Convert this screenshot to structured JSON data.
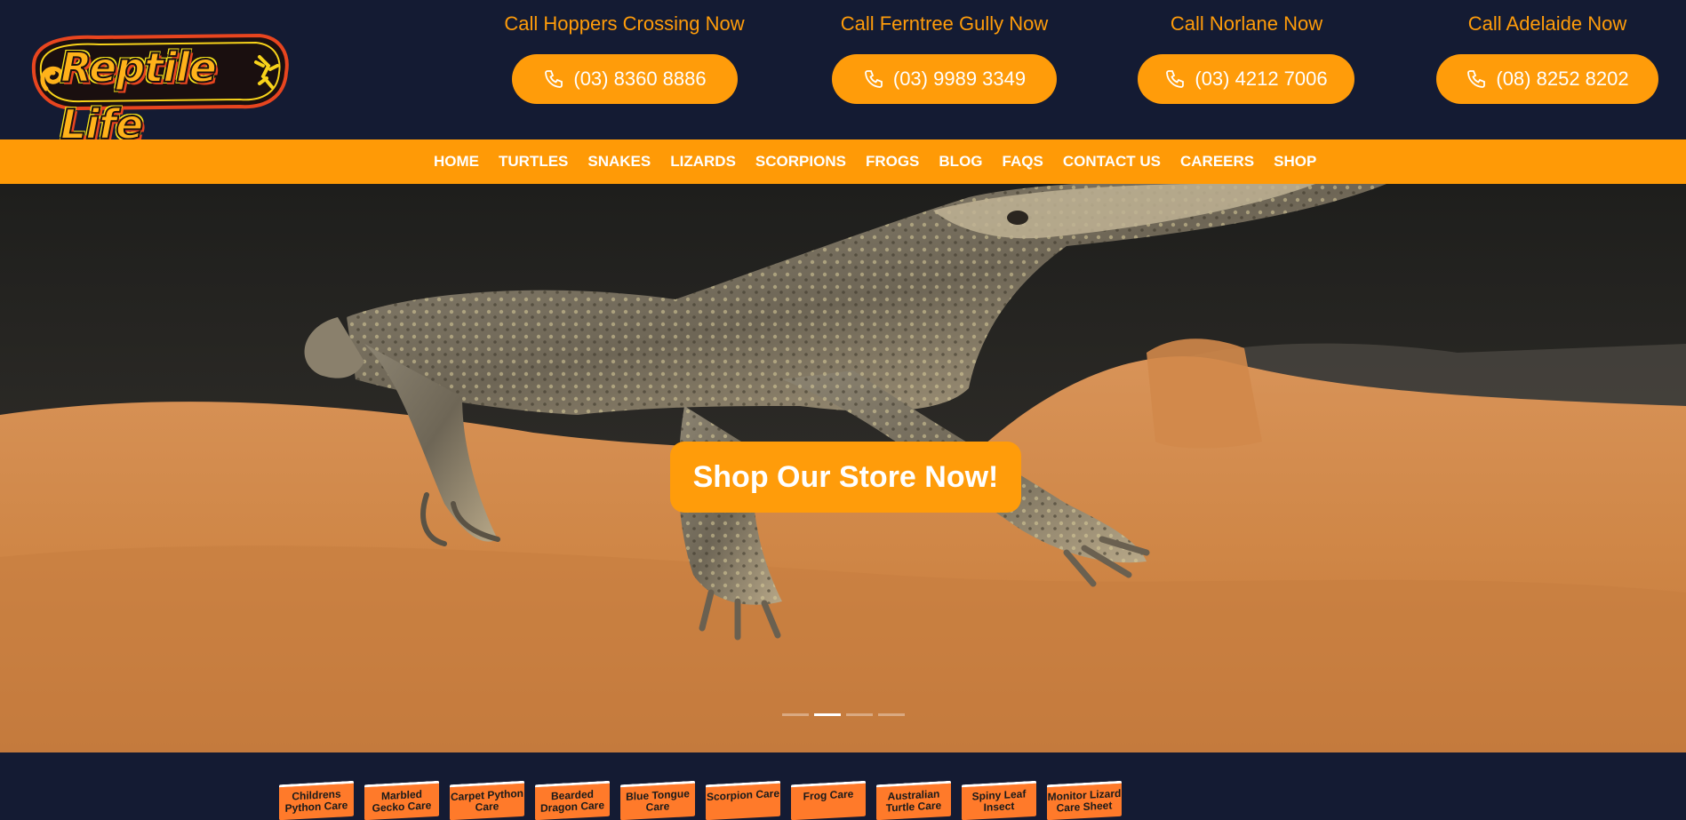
{
  "brand": {
    "name": "Reptile Life"
  },
  "locations": [
    {
      "title": "Call Hoppers Crossing Now",
      "phone": "(03) 8360 8886"
    },
    {
      "title": "Call Ferntree Gully Now",
      "phone": "(03) 9989 3349"
    },
    {
      "title": "Call Norlane Now",
      "phone": "(03) 4212 7006"
    },
    {
      "title": "Call Adelaide Now",
      "phone": "(08) 8252 8202"
    }
  ],
  "nav": {
    "items": [
      "HOME",
      "TURTLES",
      "SNAKES",
      "LIZARDS",
      "SCORPIONS",
      "FROGS",
      "BLOG",
      "FAQS",
      "CONTACT US",
      "CAREERS",
      "SHOP"
    ]
  },
  "hero": {
    "cta_label": "Shop Our Store Now!",
    "slides_total": 4,
    "active_slide": 2
  },
  "care_books": [
    "Childrens Python Care",
    "Marbled Gecko Care",
    "Carpet Python Care",
    "Bearded Dragon Care",
    "Blue Tongue Care",
    "Scorpion Care",
    "Frog Care",
    "Australian Turtle Care",
    "Spiny Leaf Insect",
    "Monitor Lizard Care Sheet"
  ],
  "colors": {
    "header_bg": "#141b33",
    "accent": "#ff9c0a",
    "nav_bg": "#ff9a06",
    "button_text": "#ffffff"
  },
  "icons": {
    "phone": "phone-icon"
  }
}
